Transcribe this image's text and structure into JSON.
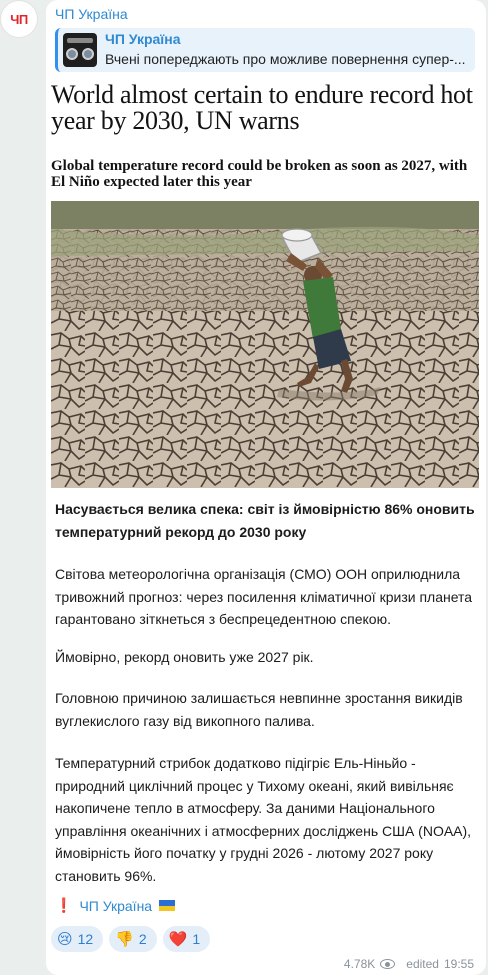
{
  "channel": {
    "avatar_text": "ЧП",
    "name": "ЧП Україна"
  },
  "reply": {
    "title": "ЧП Україна",
    "text": "Вчені попереджають про можливе повернення супер-..."
  },
  "article_image": {
    "headline": "World almost certain to endure record hot year by 2030, UN warns",
    "subheadline": "Global temperature record could be broken as soon as 2027, with El Niño expected later this year"
  },
  "post": {
    "lead": "Насувається велика спека: світ із ймовірністю 86% оновить температурний рекорд до 2030 року",
    "paragraphs": [
      "Світова метеорологічна організація (СМО) ООН оприлюднила тривожний прогноз: через посилення кліматичної кризи планета гарантовано зіткнеться з беспрецедентною спекою.",
      "Ймовірно, рекорд оновить уже 2027 рік.",
      "Головною причиною залишається невпинне зростання викидів вуглекислого газу від викопного палива.",
      "Температурний стрибок додатково підігріє Ель-Ніньйо - природний циклічний процес у Тихому океані, який вивільняє накопичене тепло в атмосферу. За даними Національного управління океанічних і атмосферних досліджень США (NOAA), ймовірність його початку у грудні 2026 - лютому 2027 року становить 96%."
    ],
    "signature_mark": "❗️",
    "signature_link": "ЧП Україна"
  },
  "reactions": [
    {
      "emoji": "😢",
      "count": "12"
    },
    {
      "emoji": "👎",
      "count": "2"
    },
    {
      "emoji": "❤️",
      "count": "1"
    }
  ],
  "meta": {
    "views": "4.78K",
    "edited": "edited",
    "time": "19:55"
  },
  "colors": {
    "link": "#2f8ad1",
    "reply_bg": "#e8f2fb",
    "reaction_bg": "#e4eef8",
    "background": "#eaeeec"
  }
}
